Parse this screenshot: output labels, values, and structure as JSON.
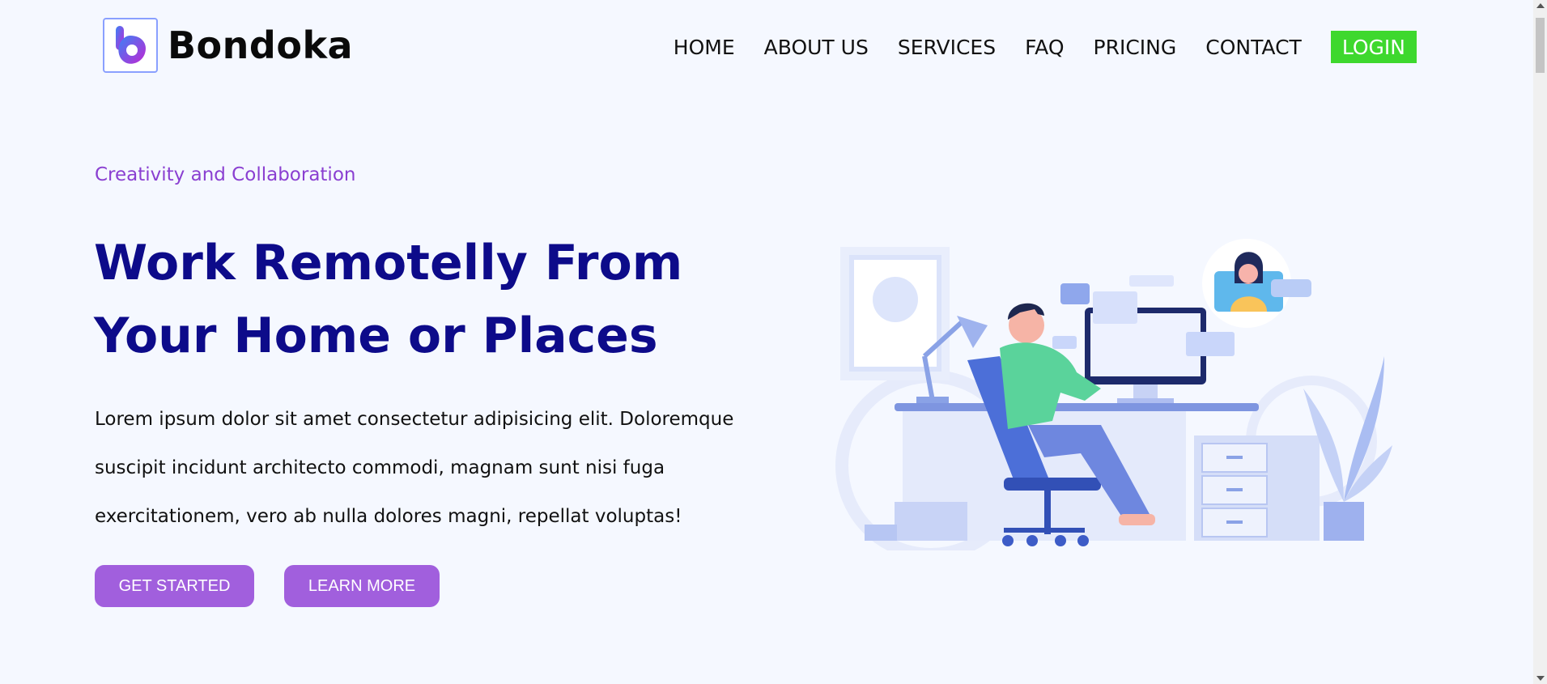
{
  "brand": {
    "name": "Bondoka",
    "logo_icon": "bondoka-logo-icon"
  },
  "nav": {
    "items": [
      "HOME",
      "ABOUT US",
      "SERVICES",
      "FAQ",
      "PRICING",
      "CONTACT"
    ],
    "login_label": "LOGIN"
  },
  "hero": {
    "eyebrow": "Creativity and Collaboration",
    "title_line1": "Work Remotelly From",
    "title_line2": "Your Home or Places",
    "description": "Lorem ipsum dolor sit amet consectetur adipisicing elit. Doloremque suscipit incidunt architecto commodi, magnam sunt nisi fuga exercitationem, vero ab nulla dolores magni, repellat voluptas!",
    "primary_button": "GET STARTED",
    "secondary_button": "LEARN MORE"
  },
  "colors": {
    "background": "#f5f8ff",
    "accent_purple": "#a15fdd",
    "title_navy": "#0d0b8a",
    "login_green": "#3ed82e",
    "eyebrow_purple": "#8a3fd1"
  },
  "illustration": {
    "icon": "remote-work-illustration"
  }
}
